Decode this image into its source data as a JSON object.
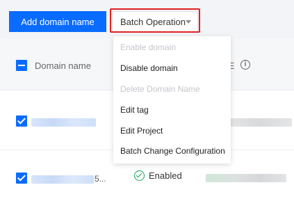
{
  "toolbar": {
    "add_button_label": "Add domain name",
    "batch_button_label": "Batch Operation"
  },
  "table": {
    "headers": {
      "name": "Domain name",
      "cname": "IE"
    },
    "rows": [
      {
        "selected": true,
        "name_suffix": "",
        "status": ""
      },
      {
        "selected": true,
        "name_suffix": "5...",
        "status": "Enabled"
      }
    ]
  },
  "dropdown": {
    "items": [
      {
        "label": "Enable domain",
        "disabled": true
      },
      {
        "label": "Disable domain",
        "disabled": false
      },
      {
        "label": "Delete Domain Name",
        "disabled": true
      },
      {
        "label": "Edit tag",
        "disabled": false
      },
      {
        "label": "Edit Project",
        "disabled": false
      },
      {
        "label": "Batch Change Configuration",
        "disabled": false
      }
    ]
  },
  "colors": {
    "primary": "#0a6cff",
    "highlight_border": "#e02020",
    "status_green": "#18a058",
    "disabled_text": "#c3c6cc"
  }
}
